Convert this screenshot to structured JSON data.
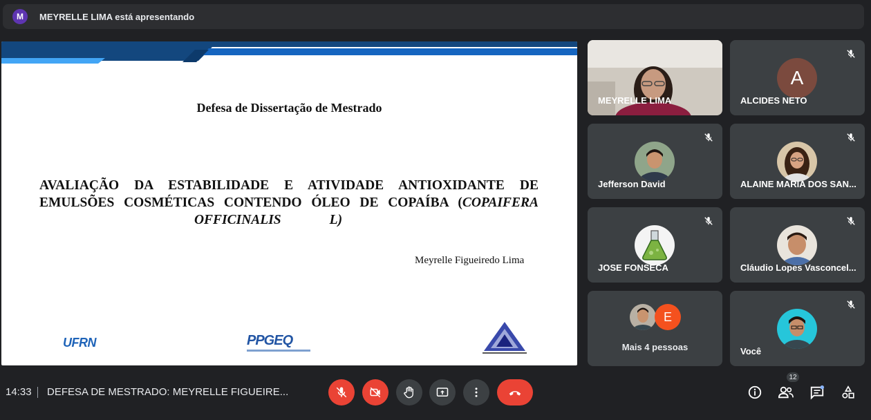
{
  "banner": {
    "avatar_letter": "M",
    "text": "MEYRELLE LIMA está apresentando"
  },
  "slide": {
    "title": "Defesa de Dissertação de Mestrado",
    "main_line1": "AVALIAÇÃO DA ESTABILIDADE E ATIVIDADE ANTIOXIDANTE DE",
    "main_line2_a": "EMULSÕES COSMÉTICAS CONTENDO ÓLEO DE COPAÍBA (",
    "main_line2_b": "COPAIFERA",
    "main_line3_a": "OFFICINALIS",
    "main_line3_b": "L)",
    "author": "Meyrelle Figueiredo Lima",
    "logo_ufrn": "UFRN",
    "logo_ppgeq": "PPGEQ"
  },
  "participants": [
    {
      "name": "MEYRELLE LIMA",
      "muted": false,
      "kind": "video"
    },
    {
      "name": "ALCIDES NETO",
      "muted": true,
      "kind": "letter",
      "letter": "A"
    },
    {
      "name": "Jefferson David",
      "muted": true,
      "kind": "photo"
    },
    {
      "name": "ALAINE MARIA DOS SAN...",
      "muted": true,
      "kind": "photo"
    },
    {
      "name": "JOSE FONSECA",
      "muted": true,
      "kind": "flask"
    },
    {
      "name": "Cláudio Lopes Vasconcel...",
      "muted": true,
      "kind": "photo"
    },
    {
      "name": "Mais 4 pessoas",
      "muted": false,
      "kind": "group",
      "letter": "E"
    },
    {
      "name": "Você",
      "muted": true,
      "kind": "photo"
    }
  ],
  "bottom": {
    "time": "14:33",
    "meeting_title": "DEFESA DE MESTRADO: MEYRELLE FIGUEIRE...",
    "people_count": "12"
  },
  "colors": {
    "accent_red": "#ea4335",
    "tile_bg": "#3c4043",
    "page_bg": "#202124"
  }
}
